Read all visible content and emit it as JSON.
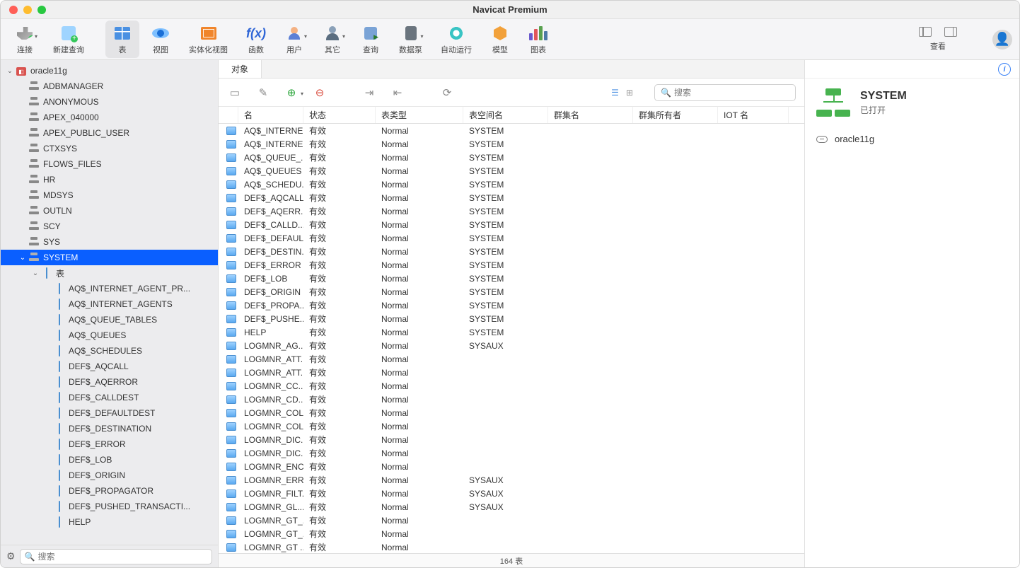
{
  "app_title": "Navicat Premium",
  "toolbar": [
    {
      "id": "connect",
      "label": "连接",
      "dropdown": true
    },
    {
      "id": "new-query",
      "label": "新建查询"
    },
    {
      "id": "table",
      "label": "表",
      "active": true
    },
    {
      "id": "view",
      "label": "视图"
    },
    {
      "id": "mview",
      "label": "实体化视图"
    },
    {
      "id": "function",
      "label": "函数"
    },
    {
      "id": "user",
      "label": "用户",
      "dropdown": true
    },
    {
      "id": "other",
      "label": "其它",
      "dropdown": true
    },
    {
      "id": "query",
      "label": "查询"
    },
    {
      "id": "pump",
      "label": "数据泵",
      "dropdown": true
    },
    {
      "id": "auto",
      "label": "自动运行"
    },
    {
      "id": "model",
      "label": "模型"
    },
    {
      "id": "chart",
      "label": "图表"
    }
  ],
  "toolbar_right_label": "查看",
  "sidebar": {
    "connection": "oracle11g",
    "schemas": [
      "ADBMANAGER",
      "ANONYMOUS",
      "APEX_040000",
      "APEX_PUBLIC_USER",
      "CTXSYS",
      "FLOWS_FILES",
      "HR",
      "MDSYS",
      "OUTLN",
      "SCY",
      "SYS"
    ],
    "selected_schema": "SYSTEM",
    "tables_node": "表",
    "tables": [
      "AQ$_INTERNET_AGENT_PR...",
      "AQ$_INTERNET_AGENTS",
      "AQ$_QUEUE_TABLES",
      "AQ$_QUEUES",
      "AQ$_SCHEDULES",
      "DEF$_AQCALL",
      "DEF$_AQERROR",
      "DEF$_CALLDEST",
      "DEF$_DEFAULTDEST",
      "DEF$_DESTINATION",
      "DEF$_ERROR",
      "DEF$_LOB",
      "DEF$_ORIGIN",
      "DEF$_PROPAGATOR",
      "DEF$_PUSHED_TRANSACTI...",
      "HELP"
    ],
    "search_placeholder": "搜索"
  },
  "tabs": {
    "object": "对象"
  },
  "obj_search_placeholder": "搜索",
  "columns": {
    "name": "名",
    "status": "状态",
    "type": "表类型",
    "tablespace": "表空间名",
    "cluster": "群集名",
    "cluster_owner": "群集所有者",
    "iot": "IOT 名",
    "widths": {
      "icon": 28,
      "name": 92,
      "status": 102,
      "type": 124,
      "tablespace": 120,
      "cluster": 120,
      "cluster_owner": 120,
      "iot": 100
    }
  },
  "rows": [
    {
      "name": "AQ$_INTERNE..",
      "status": "有效",
      "type": "Normal",
      "ts": "SYSTEM"
    },
    {
      "name": "AQ$_INTERNE..",
      "status": "有效",
      "type": "Normal",
      "ts": "SYSTEM"
    },
    {
      "name": "AQ$_QUEUE_...",
      "status": "有效",
      "type": "Normal",
      "ts": "SYSTEM"
    },
    {
      "name": "AQ$_QUEUES",
      "status": "有效",
      "type": "Normal",
      "ts": "SYSTEM"
    },
    {
      "name": "AQ$_SCHEDU..",
      "status": "有效",
      "type": "Normal",
      "ts": "SYSTEM"
    },
    {
      "name": "DEF$_AQCALL",
      "status": "有效",
      "type": "Normal",
      "ts": "SYSTEM"
    },
    {
      "name": "DEF$_AQERR...",
      "status": "有效",
      "type": "Normal",
      "ts": "SYSTEM"
    },
    {
      "name": "DEF$_CALLD...",
      "status": "有效",
      "type": "Normal",
      "ts": "SYSTEM"
    },
    {
      "name": "DEF$_DEFAUL..",
      "status": "有效",
      "type": "Normal",
      "ts": "SYSTEM"
    },
    {
      "name": "DEF$_DESTIN..",
      "status": "有效",
      "type": "Normal",
      "ts": "SYSTEM"
    },
    {
      "name": "DEF$_ERROR",
      "status": "有效",
      "type": "Normal",
      "ts": "SYSTEM"
    },
    {
      "name": "DEF$_LOB",
      "status": "有效",
      "type": "Normal",
      "ts": "SYSTEM"
    },
    {
      "name": "DEF$_ORIGIN",
      "status": "有效",
      "type": "Normal",
      "ts": "SYSTEM"
    },
    {
      "name": "DEF$_PROPA...",
      "status": "有效",
      "type": "Normal",
      "ts": "SYSTEM"
    },
    {
      "name": "DEF$_PUSHE...",
      "status": "有效",
      "type": "Normal",
      "ts": "SYSTEM"
    },
    {
      "name": "HELP",
      "status": "有效",
      "type": "Normal",
      "ts": "SYSTEM"
    },
    {
      "name": "LOGMNR_AG...",
      "status": "有效",
      "type": "Normal",
      "ts": "SYSAUX"
    },
    {
      "name": "LOGMNR_ATT..",
      "status": "有效",
      "type": "Normal",
      "ts": ""
    },
    {
      "name": "LOGMNR_ATT..",
      "status": "有效",
      "type": "Normal",
      "ts": ""
    },
    {
      "name": "LOGMNR_CC...",
      "status": "有效",
      "type": "Normal",
      "ts": ""
    },
    {
      "name": "LOGMNR_CD...",
      "status": "有效",
      "type": "Normal",
      "ts": ""
    },
    {
      "name": "LOGMNR_COL$",
      "status": "有效",
      "type": "Normal",
      "ts": ""
    },
    {
      "name": "LOGMNR_COL..",
      "status": "有效",
      "type": "Normal",
      "ts": ""
    },
    {
      "name": "LOGMNR_DIC..",
      "status": "有效",
      "type": "Normal",
      "ts": ""
    },
    {
      "name": "LOGMNR_DIC...",
      "status": "有效",
      "type": "Normal",
      "ts": ""
    },
    {
      "name": "LOGMNR_ENC$",
      "status": "有效",
      "type": "Normal",
      "ts": ""
    },
    {
      "name": "LOGMNR_ERR..",
      "status": "有效",
      "type": "Normal",
      "ts": "SYSAUX"
    },
    {
      "name": "LOGMNR_FILT..",
      "status": "有效",
      "type": "Normal",
      "ts": "SYSAUX"
    },
    {
      "name": "LOGMNR_GL...",
      "status": "有效",
      "type": "Normal",
      "ts": "SYSAUX"
    },
    {
      "name": "LOGMNR_GT_..",
      "status": "有效",
      "type": "Normal",
      "ts": ""
    },
    {
      "name": "LOGMNR_GT_...",
      "status": "有效",
      "type": "Normal",
      "ts": ""
    },
    {
      "name": "LOGMNR_GT ...",
      "status": "有效",
      "type": "Normal",
      "ts": ""
    }
  ],
  "status_text": "164 表",
  "rightpane": {
    "title": "SYSTEM",
    "subtitle": "已打开",
    "connection": "oracle11g"
  }
}
